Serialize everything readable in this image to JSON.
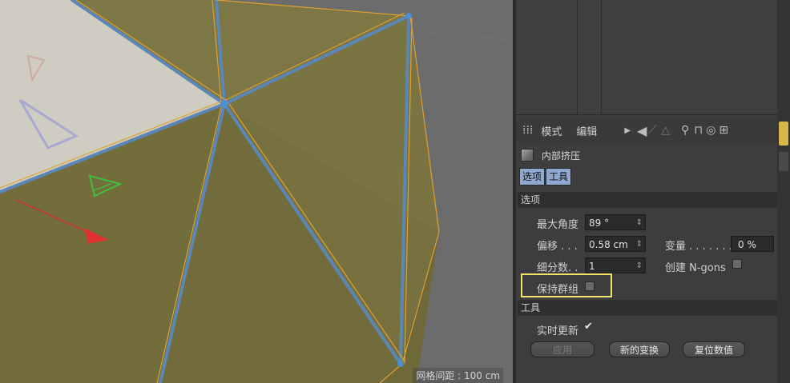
{
  "viewport": {
    "grid_spacing_label": "网格间距 : 100 cm"
  },
  "attribute_manager": {
    "toolbar": {
      "menu_mode": "模式",
      "menu_edit": "编辑"
    },
    "tool_name": "内部挤压",
    "tabs": [
      {
        "label": "选项",
        "active": true
      },
      {
        "label": "工具",
        "active": true
      }
    ],
    "options_section": {
      "header": "选项",
      "max_angle_label": "最大角度",
      "max_angle_value": "89 °",
      "offset_label": "偏移 . . .",
      "offset_value": "0.58 cm",
      "variance_label": "变量 . . . . . . .",
      "variance_value": "0 %",
      "subdivision_label": "细分数. .",
      "subdivision_value": "1",
      "create_ngons_label": "创建 N-gons",
      "create_ngons_checked": false,
      "preserve_groups_label": "保持群组",
      "preserve_groups_checked": false
    },
    "tool_section": {
      "header": "工具",
      "realtime_update_label": "实时更新",
      "realtime_update_checked": true,
      "checkmark": "✔",
      "apply_button": "应用",
      "new_transform_button": "新的变换",
      "reset_values_button": "复位数值"
    }
  },
  "colors": {
    "face_fill": "#7a7442",
    "face_selected": "#cfccc2",
    "edge_blue": "#5a86b8",
    "edge_orange": "#e0a030",
    "highlight": "#f1e36b",
    "tab_active": "#8ea8d0",
    "side_tab_active": "#d9b64a"
  },
  "icons": {
    "grip": "grip-icon",
    "arrow_right": "triangle-right-icon",
    "back_arrow": "back-arrow-icon",
    "search": "search-icon",
    "lock": "lock-icon",
    "target": "target-icon",
    "new_panel": "new-panel-icon",
    "cube": "cube-icon"
  }
}
